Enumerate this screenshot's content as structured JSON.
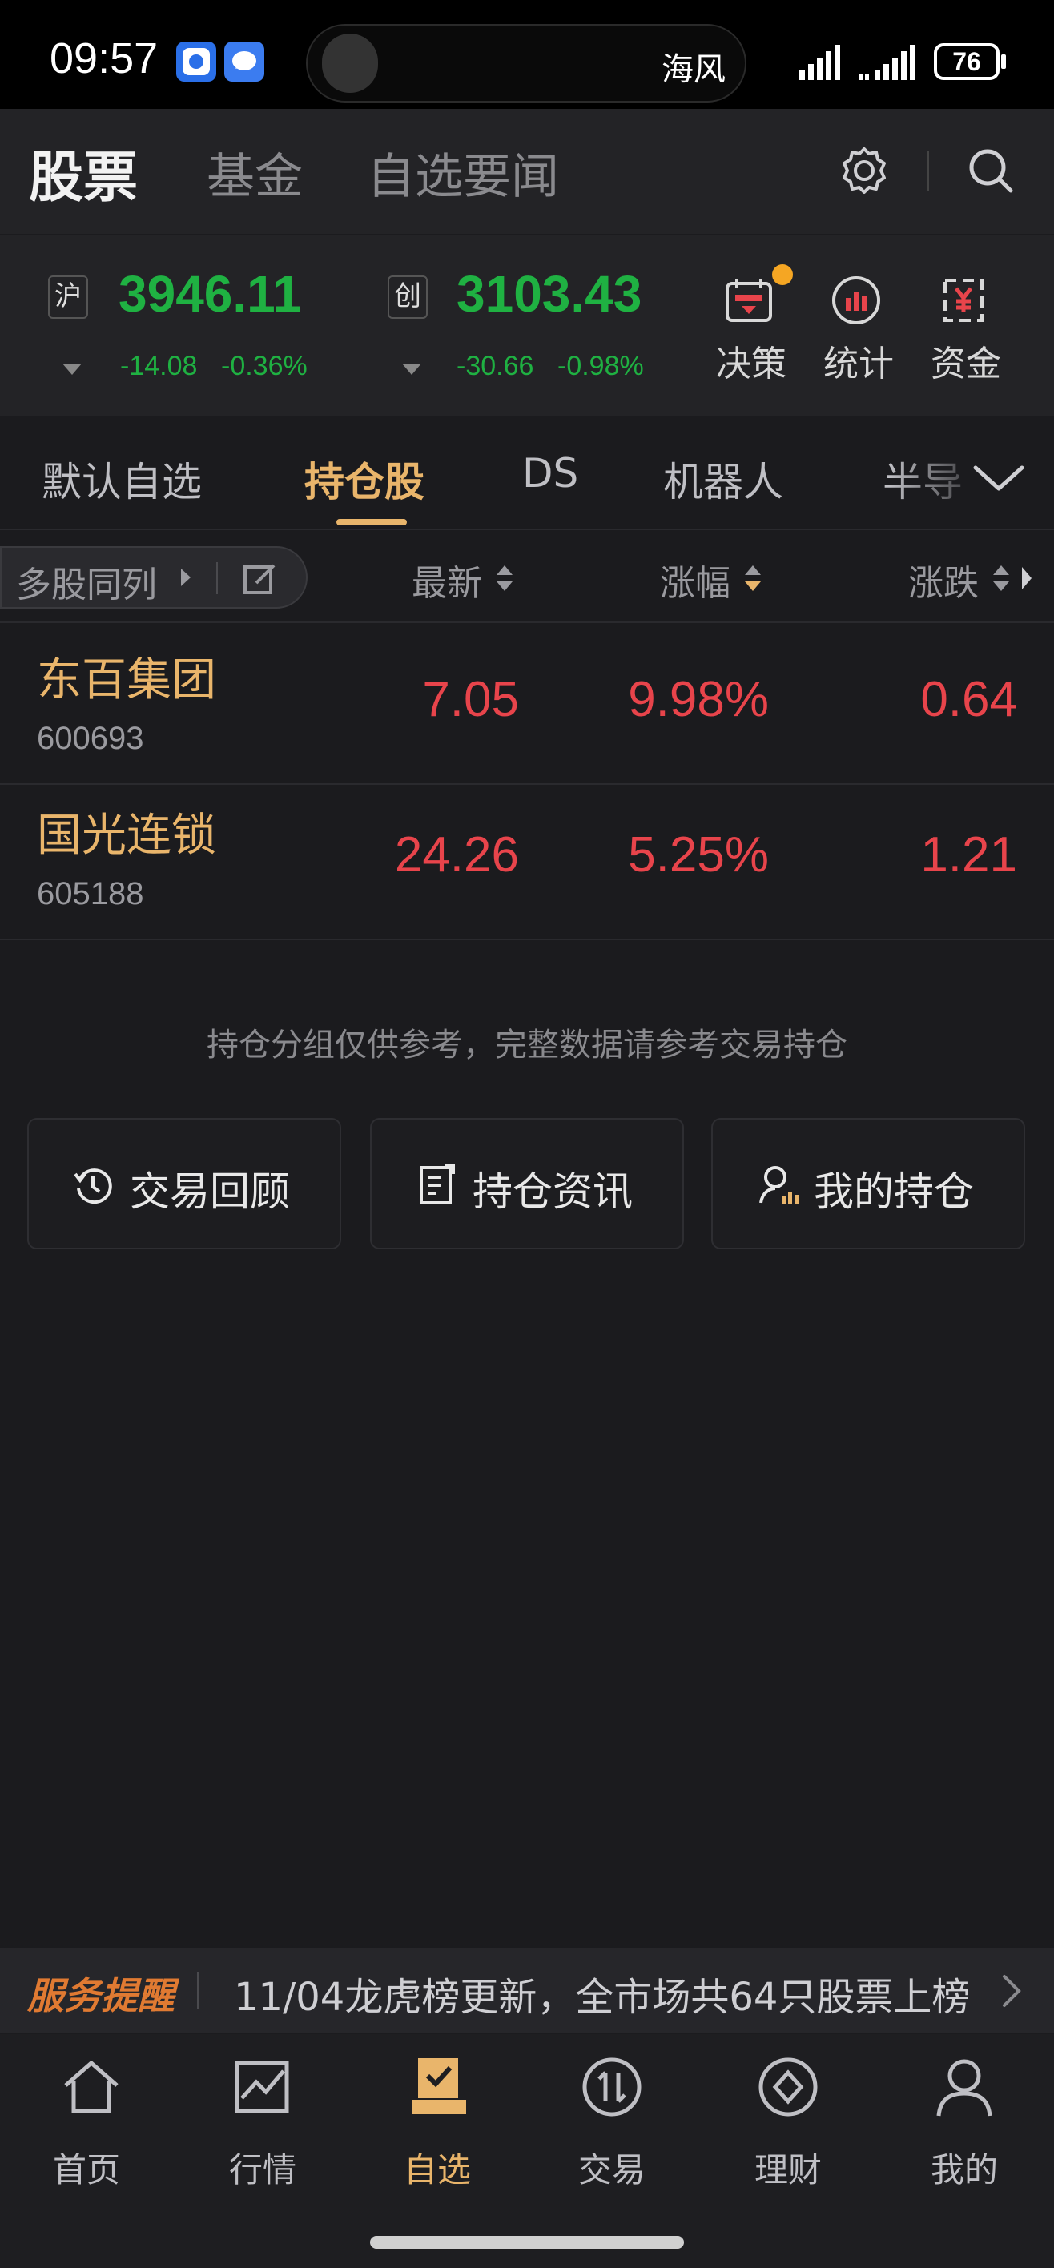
{
  "status_bar": {
    "time": "09:57",
    "island_label": "海风",
    "battery": "76"
  },
  "header": {
    "tabs": [
      {
        "label": "股票",
        "active": true
      },
      {
        "label": "基金",
        "active": false
      },
      {
        "label": "自选要闻",
        "active": false
      }
    ],
    "icons": [
      "gear-icon",
      "search-icon"
    ]
  },
  "indices": [
    {
      "tag": "沪",
      "value": "3946.11",
      "change": "-14.08",
      "pct": "-0.36%"
    },
    {
      "tag": "创",
      "value": "3103.43",
      "change": "-30.66",
      "pct": "-0.98%"
    }
  ],
  "tools": [
    {
      "label": "决策",
      "icon": "calendar-icon",
      "badge": true
    },
    {
      "label": "统计",
      "icon": "bar-chart-icon",
      "badge": false
    },
    {
      "label": "资金",
      "icon": "yuan-icon",
      "badge": false
    }
  ],
  "group_tabs": [
    {
      "label": "默认自选",
      "active": false
    },
    {
      "label": "持仓股",
      "active": true
    },
    {
      "label": "DS",
      "active": false
    },
    {
      "label": "机器人",
      "active": false
    },
    {
      "label": "半导",
      "active": false
    }
  ],
  "columns": {
    "multi_label": "多股同列",
    "latest": "最新",
    "change_pct": "涨幅",
    "change": "涨跌"
  },
  "rows": [
    {
      "name": "东百集团",
      "code": "600693",
      "latest": "7.05",
      "change_pct": "9.98%",
      "change": "0.64"
    },
    {
      "name": "国光连锁",
      "code": "605188",
      "latest": "24.26",
      "change_pct": "5.25%",
      "change": "1.21"
    }
  ],
  "note": "持仓分组仅供参考，完整数据请参考交易持仓",
  "actions": [
    {
      "label": "交易回顾",
      "icon": "clock-icon"
    },
    {
      "label": "持仓资讯",
      "icon": "news-icon"
    },
    {
      "label": "我的持仓",
      "icon": "user-holding-icon"
    }
  ],
  "service": {
    "title": "服务提醒",
    "message": "11/04龙虎榜更新，全市场共64只股票上榜"
  },
  "nav": [
    {
      "label": "首页",
      "icon": "home-icon",
      "active": false
    },
    {
      "label": "行情",
      "icon": "chart-icon",
      "active": false
    },
    {
      "label": "自选",
      "icon": "watchlist-icon",
      "active": true
    },
    {
      "label": "交易",
      "icon": "trade-icon",
      "active": false
    },
    {
      "label": "理财",
      "icon": "wealth-icon",
      "active": false
    },
    {
      "label": "我的",
      "icon": "profile-icon",
      "active": false
    }
  ],
  "colors": {
    "accent": "#e9b56b",
    "up": "#e8444b",
    "down": "#1fb142",
    "service": "#e07a32"
  }
}
